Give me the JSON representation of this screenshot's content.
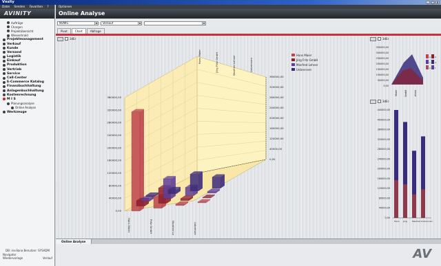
{
  "window": {
    "title": "Vnsity"
  },
  "sidebar": {
    "menu": [
      "Datei",
      "Senden",
      "Favoriten",
      "?"
    ],
    "logo": "AVINITY",
    "items": [
      {
        "label": "Aufträge",
        "type": "sub"
      },
      {
        "label": "Chargen",
        "type": "sub"
      },
      {
        "label": "Projektübersicht",
        "type": "sub"
      },
      {
        "label": "Wiesenhrald",
        "type": "sub"
      },
      {
        "label": "Projektmanagement",
        "type": "main"
      },
      {
        "label": "Verkauf",
        "type": "main"
      },
      {
        "label": "Kunde",
        "type": "main"
      },
      {
        "label": "Versand",
        "type": "main"
      },
      {
        "label": "Logistik",
        "type": "main"
      },
      {
        "label": "Einkauf",
        "type": "main"
      },
      {
        "label": "Produktion",
        "type": "main"
      },
      {
        "label": "Vertrieb",
        "type": "main"
      },
      {
        "label": "Service",
        "type": "main"
      },
      {
        "label": "Call-Center",
        "type": "main"
      },
      {
        "label": "E-Commerce Katalog",
        "type": "main"
      },
      {
        "label": "Finanzbuchhaltung",
        "type": "main"
      },
      {
        "label": "Anlagenbuchhaltung",
        "type": "main"
      },
      {
        "label": "Kostenrechnung",
        "type": "main"
      },
      {
        "label": "M I S",
        "type": "main-red"
      },
      {
        "label": "Planungsanalyse",
        "type": "sub"
      },
      {
        "label": "Online Analyse",
        "type": "sub2"
      },
      {
        "label": "Werkzeuge",
        "type": "main"
      }
    ],
    "footer_user": "DB: inviliana   Benutzer: SYSADM",
    "footer_left": "Navigator",
    "footer_left2": "Wiedervorlage",
    "footer_right": "Verlauf"
  },
  "main": {
    "menu": "Optionen",
    "title": "Online Analyse",
    "select1": "NVMIS",
    "select2": "Verkauf",
    "select3": "",
    "tabs": [
      "Pivot",
      "Chart",
      "Abfrage"
    ],
    "active_tab": "Chart",
    "bottom_tab": "Online Analyse",
    "toolbar_label": "3dEr",
    "colors": {
      "accent_red": "#c8323c",
      "series1": "#c0444c",
      "series2": "#8c1f2c",
      "series3": "#5c3f9c",
      "series4": "#3a2c7c"
    }
  },
  "chart_data": [
    {
      "type": "bar",
      "title": "",
      "series": [
        {
          "name": "Hans Maier",
          "values": [
            350000,
            40000,
            5000,
            3000
          ]
        },
        {
          "name": "Jörg Fritz GmbH",
          "values": [
            20000,
            55000,
            8000,
            2000
          ]
        },
        {
          "name": "Manfred Lehner",
          "values": [
            10000,
            70000,
            30000,
            6000
          ]
        },
        {
          "name": "Unbrennen",
          "values": [
            5000,
            15000,
            60000,
            40000
          ]
        }
      ],
      "categories": [
        "Hans Maier",
        "Fritz GmbH",
        "Manfred Lehner",
        "Unbrennen"
      ],
      "ylim": [
        0,
        400000
      ],
      "y_ticks": [
        "0,00",
        "40000,00",
        "80000,00",
        "120000,00",
        "160000,00",
        "200000,00",
        "240000,00",
        "280000,00",
        "320000,00",
        "360000,00"
      ],
      "right_ticks": [
        "0,00",
        "40000,00",
        "120000,00",
        "160000,00",
        "200000,00",
        "240000,00",
        "280000,00",
        "320000,00",
        "360000,00"
      ]
    },
    {
      "type": "bar",
      "title": "",
      "categories": [
        "Hans Maier",
        "Jörg Fritz GmbH",
        "Manfred Lehner",
        "Unbrennen"
      ],
      "series": [
        {
          "name": "",
          "values": [
            450000,
            400000,
            280000,
            340000
          ]
        }
      ],
      "ylim": [
        0,
        450000
      ],
      "y_ticks": [
        "0,00",
        "40000,00",
        "80000,00",
        "120000,00",
        "160000,00",
        "200000,00",
        "240000,00",
        "280000,00",
        "320000,00",
        "360000,00",
        "400000,00",
        "440000,00"
      ]
    },
    {
      "type": "area",
      "title": "",
      "y_ticks": [
        "0,00",
        "50000,00",
        "100000,00",
        "150000,00",
        "200000,00",
        "250000,00",
        "300000,00",
        "350000,00"
      ],
      "categories": [
        "Hans Maier",
        "Fritz GmbH",
        "Manfred Lehner"
      ],
      "legend": [
        "a",
        "b",
        "c",
        "d",
        "e",
        "f"
      ]
    }
  ]
}
